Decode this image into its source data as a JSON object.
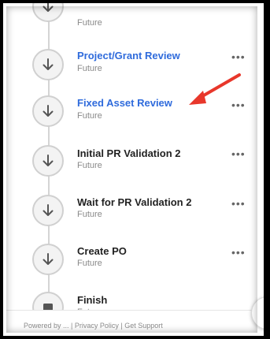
{
  "steps": [
    {
      "title": "",
      "status": "Future",
      "link": false,
      "icon": "arrow-down-icon",
      "menu": false
    },
    {
      "title": "Project/Grant Review",
      "status": "Future",
      "link": true,
      "icon": "arrow-down-icon",
      "menu": true
    },
    {
      "title": "Fixed Asset Review",
      "status": "Future",
      "link": true,
      "icon": "arrow-down-icon",
      "menu": true
    },
    {
      "title": "Initial PR Validation 2",
      "status": "Future",
      "link": false,
      "icon": "arrow-down-icon",
      "menu": true
    },
    {
      "title": "Wait for PR Validation 2",
      "status": "Future",
      "link": false,
      "icon": "arrow-down-icon",
      "menu": true
    },
    {
      "title": "Create PO",
      "status": "Future",
      "link": false,
      "icon": "arrow-down-icon",
      "menu": true
    },
    {
      "title": "Finish",
      "status": "Future",
      "link": false,
      "icon": "stop-square-icon",
      "menu": false
    }
  ],
  "more_label": "•••",
  "footer": {
    "text": "Powered by ... | Privacy Policy | Get Support"
  },
  "annotation": {
    "color": "#e8372b",
    "icon": "red-arrow-annotation"
  },
  "colors": {
    "link": "#2f6bdc",
    "text": "#222222",
    "muted": "#8a8a8a"
  }
}
